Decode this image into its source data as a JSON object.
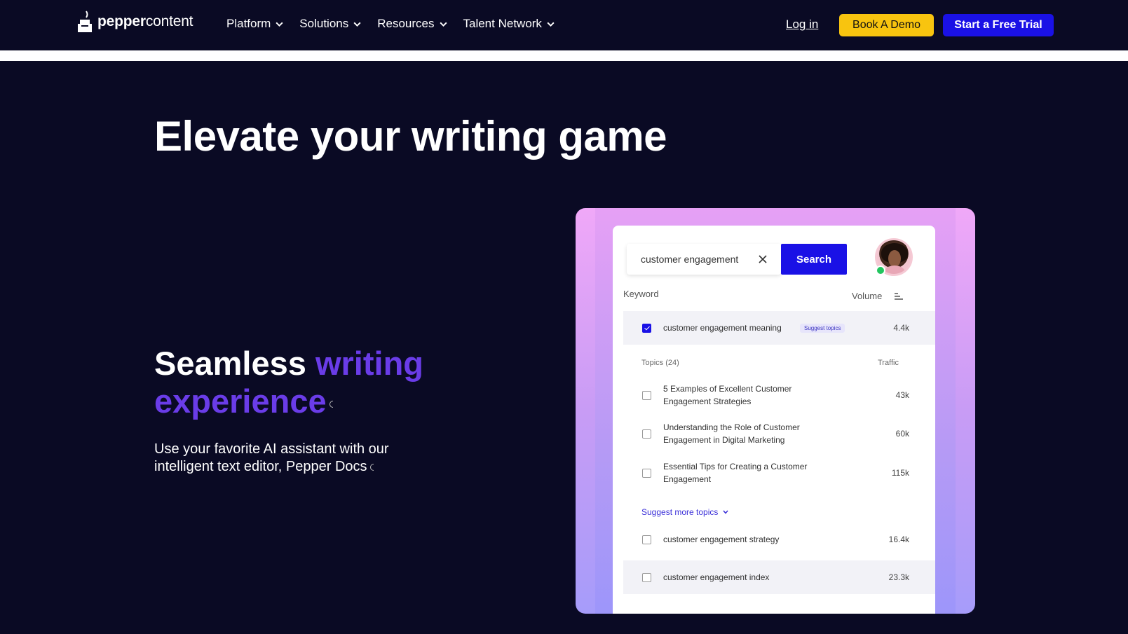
{
  "brand": {
    "name_bold": "pepper",
    "name_light": "content"
  },
  "nav": {
    "menu": [
      {
        "label": "Platform"
      },
      {
        "label": "Solutions"
      },
      {
        "label": "Resources"
      },
      {
        "label": "Talent Network"
      }
    ],
    "login_label": "Log in",
    "demo_label": "Book A Demo",
    "trial_label": "Start a Free Trial"
  },
  "hero": {
    "title": "Elevate your writing game",
    "subtitle_white": "Seamless ",
    "subtitle_purple_1": "writing",
    "subtitle_purple_2": "experience",
    "body": "Use your favorite AI assistant with our intelligent text editor, Pepper Docs"
  },
  "demo": {
    "search_value": "customer engagement",
    "search_button": "Search",
    "col_keyword": "Keyword",
    "col_volume": "Volume",
    "primary": {
      "label": "customer engagement meaning",
      "badge": "Suggest topics",
      "value": "4.4k",
      "checked": true
    },
    "topics_header": "Topics (24)",
    "traffic_header": "Traffic",
    "topics": [
      {
        "label": "5 Examples of Excellent Customer Engagement Strategies",
        "value": "43k"
      },
      {
        "label": "Understanding the Role of Customer Engagement in Digital Marketing",
        "value": "60k"
      },
      {
        "label": "Essential Tips for Creating a Customer Engagement",
        "value": "115k"
      }
    ],
    "suggest_more": "Suggest more topics",
    "keywords": [
      {
        "label": "customer engagement strategy",
        "value": "16.4k"
      },
      {
        "label": "customer engagement index",
        "value": "23.3k"
      }
    ]
  },
  "colors": {
    "background": "#0a0a24",
    "accent_yellow": "#f8c40f",
    "accent_blue": "#1a11e6",
    "accent_purple": "#6a3ce8"
  }
}
